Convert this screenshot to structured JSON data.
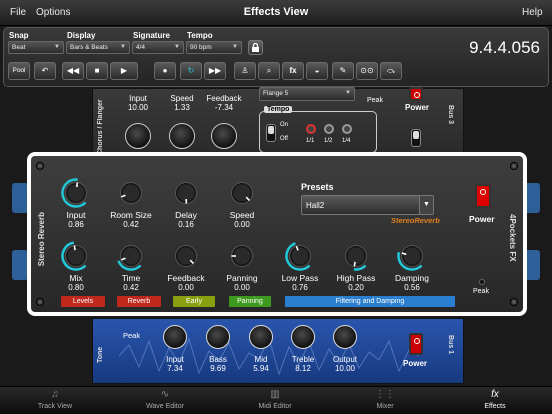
{
  "menu": {
    "file": "File",
    "options": "Options",
    "title": "Effects View",
    "help": "Help"
  },
  "toolbar": {
    "snap_label": "Snap",
    "snap_value": "Beat",
    "display_label": "Display",
    "display_value": "Bars & Beats",
    "signature_label": "Signature",
    "signature_value": "4/4",
    "tempo_label": "Tempo",
    "tempo_value": "90 bpm",
    "counter": "9.4.4.056",
    "pool": "Pool",
    "fx": "fx"
  },
  "chorus": {
    "side_label": "Chorus / Flanger",
    "bus": "Bus 3",
    "knobs": [
      {
        "label": "Input",
        "value": "10.00"
      },
      {
        "label": "Speed",
        "value": "1.33"
      },
      {
        "label": "Feedback",
        "value": "-7.34"
      }
    ],
    "preset": "Flange 5",
    "peak": "Peak",
    "power": "Power",
    "tempo": {
      "label": "Tempo",
      "on": "On",
      "off": "Off",
      "divs": [
        "1/1",
        "1/2",
        "1/4"
      ]
    }
  },
  "reverb": {
    "side_left": "Stereo Reverb",
    "side_right": "4Pockets FX",
    "presets_label": "Presets",
    "preset_value": "Hall2",
    "logo": "StereoReverb",
    "power": "Power",
    "peak": "Peak",
    "knobs_top": [
      {
        "label": "Input",
        "value": "0.86",
        "level": 0.86,
        "ring": true
      },
      {
        "label": "Room Size",
        "value": "0.42",
        "level": 0.42,
        "ring": false
      },
      {
        "label": "Delay",
        "value": "0.16",
        "level": 0.16,
        "ring": false
      },
      {
        "label": "Speed",
        "value": "0.00",
        "level": 0.0,
        "ring": false
      }
    ],
    "knobs_bottom": [
      {
        "label": "Mix",
        "value": "0.80",
        "level": 0.8,
        "ring": true
      },
      {
        "label": "Time",
        "value": "0.42",
        "level": 0.42,
        "ring": true
      },
      {
        "label": "Feedback",
        "value": "0.00",
        "level": 0.0,
        "ring": false
      },
      {
        "label": "Panning",
        "value": "0.00",
        "level": 0.5,
        "ring": false
      },
      {
        "label": "Low Pass",
        "value": "0.76",
        "level": 0.76,
        "ring": true
      },
      {
        "label": "High Pass",
        "value": "0.20",
        "level": 0.2,
        "ring": true
      },
      {
        "label": "Damping",
        "value": "0.56",
        "level": 0.56,
        "ring": true
      }
    ],
    "tags": [
      {
        "text": "Levels",
        "color": "#c0281e"
      },
      {
        "text": "Reverb",
        "color": "#c0281e"
      },
      {
        "text": "Early",
        "color": "#8aa010"
      },
      {
        "text": "Panning",
        "color": "#3e9a1e"
      },
      {
        "text": "Filtering and Damping",
        "color": "#2a7ecf"
      }
    ]
  },
  "tone": {
    "side_label": "Tone",
    "bus": "Bus 1",
    "peak": "Peak",
    "power": "Power",
    "knobs": [
      {
        "label": "Input",
        "value": "7.34"
      },
      {
        "label": "Bass",
        "value": "9.69"
      },
      {
        "label": "Mid",
        "value": "5.94"
      },
      {
        "label": "Treble",
        "value": "8.12"
      },
      {
        "label": "Output",
        "value": "10.00"
      }
    ]
  },
  "tabs": [
    {
      "label": "Track View",
      "icon": "music-note-icon",
      "glyph": "♫"
    },
    {
      "label": "Wave Editor",
      "icon": "waveform-icon",
      "glyph": "∿"
    },
    {
      "label": "Midi Editor",
      "icon": "keyboard-icon",
      "glyph": "▥"
    },
    {
      "label": "Mixer",
      "icon": "mixer-icon",
      "glyph": "⋮⋮"
    },
    {
      "label": "Effects",
      "icon": "fx-icon",
      "glyph": "fx"
    }
  ],
  "colors": {
    "accent": "#22c8d8",
    "power_red": "#cc0000",
    "tone_blue": "#1f4fa8"
  }
}
